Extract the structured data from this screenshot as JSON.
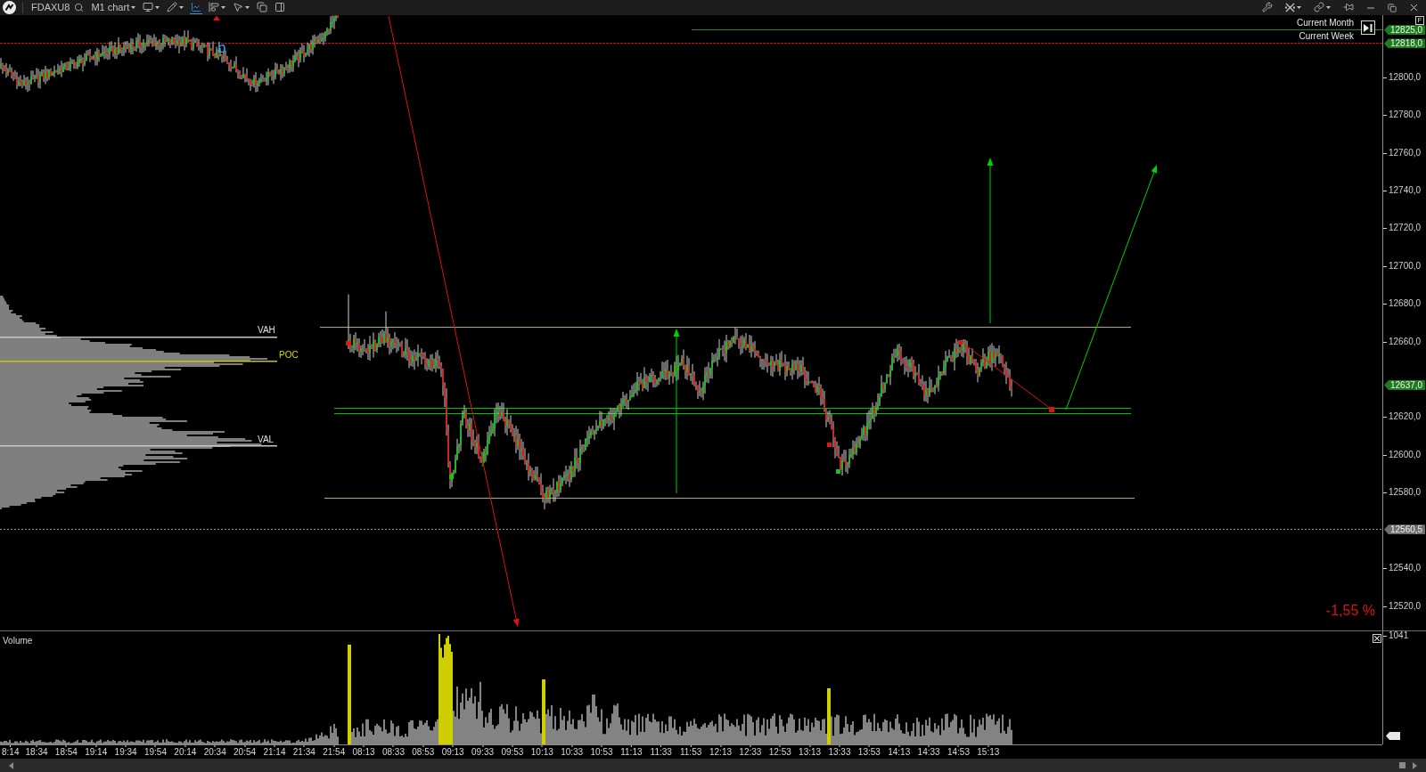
{
  "toolbar": {
    "symbol": "FDAXU8",
    "timeframe": "M1 chart",
    "tools": [
      {
        "kind": "display",
        "dropdown": true,
        "selected": false
      },
      {
        "kind": "draw",
        "dropdown": true,
        "selected": false
      },
      {
        "kind": "indicators",
        "dropdown": false,
        "selected": true
      },
      {
        "kind": "align",
        "dropdown": true,
        "selected": false
      },
      {
        "kind": "cursor",
        "dropdown": true,
        "selected": false
      },
      {
        "kind": "window",
        "dropdown": false,
        "selected": false
      },
      {
        "kind": "panel",
        "dropdown": false,
        "selected": false
      }
    ],
    "window_tools": [
      {
        "kind": "tools",
        "dropdown": false
      },
      {
        "kind": "crosshair",
        "dropdown": true
      },
      {
        "kind": "link",
        "dropdown": true
      },
      {
        "kind": "pin",
        "dropdown": false
      }
    ]
  },
  "price_pane": {
    "levels": [
      {
        "label": "Current Month",
        "color": "#1a8c1a",
        "kind": "solid"
      },
      {
        "label": "Current Week",
        "color": "#cc1111",
        "kind": "dotted"
      }
    ],
    "profile_labels": [
      {
        "text": "VAH",
        "color": "#e0e0e0"
      },
      {
        "text": "POC",
        "color": "#d8d800"
      },
      {
        "text": "VAL",
        "color": "#e0e0e0"
      }
    ],
    "wave_label": "b",
    "change": "-1,55 %"
  },
  "price_axis": {
    "corner_button": "F",
    "labels": [
      "12800,0",
      "12780,0",
      "12760,0",
      "12740,0",
      "12720,0",
      "12700,0",
      "12680,0",
      "12660,0",
      "12620,0",
      "12600,0",
      "12580,0",
      "12540,0",
      "12520,0"
    ],
    "tags": [
      {
        "text": "12825,0",
        "color": "#1b7d1b"
      },
      {
        "text": "12818,0",
        "color": "#1b7d1b"
      },
      {
        "text": "12637,0",
        "color": "#1b7d1b"
      },
      {
        "text": "12560,5",
        "color": "#6e6e6e"
      }
    ]
  },
  "volume_pane": {
    "title": "Volume",
    "axis_label": "1041"
  },
  "time_axis": {
    "labels": [
      "8:14",
      "18:34",
      "18:54",
      "19:14",
      "19:34",
      "19:54",
      "20:14",
      "20:34",
      "20:54",
      "21:14",
      "21:34",
      "21:54",
      "08:13",
      "08:33",
      "08:53",
      "09:13",
      "09:33",
      "09:53",
      "10:13",
      "10:33",
      "10:53",
      "11:13",
      "11:33",
      "11:53",
      "12:13",
      "12:33",
      "12:53",
      "13:13",
      "13:33",
      "13:53",
      "14:13",
      "14:33",
      "14:53",
      "15:13"
    ]
  }
}
